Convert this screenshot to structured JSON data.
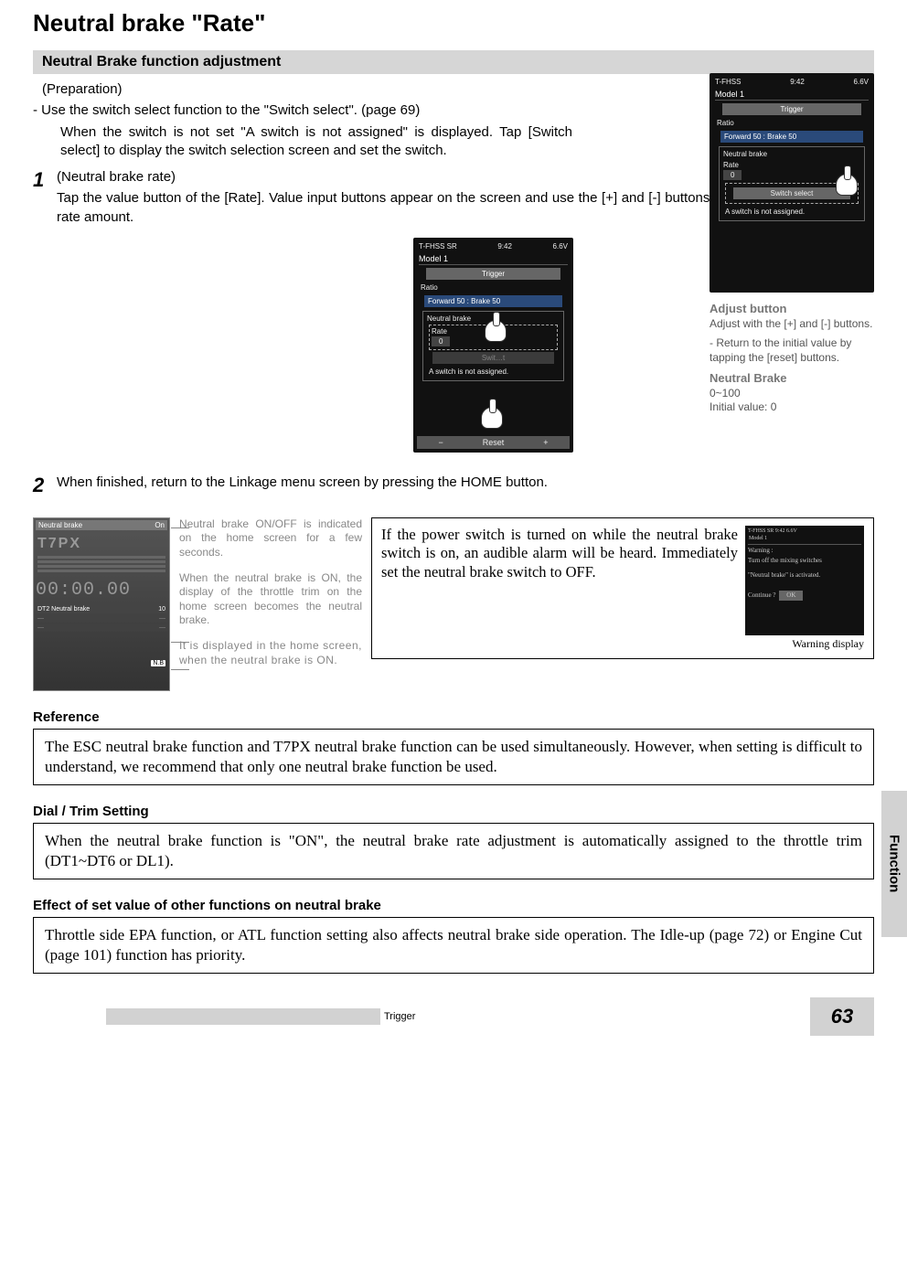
{
  "title": "Neutral brake \"Rate\"",
  "sub_bar": "Neutral Brake function adjustment",
  "preparation_label": "(Preparation)",
  "dash_line": "- Use the switch select function to the \"Switch select\". (page 69)",
  "intro_para": "When the switch is not set \"A switch is not assigned\" is displayed. Tap [Switch select] to display the switch selection screen and set the switch.",
  "step1": {
    "num": "1",
    "label": "(Neutral brake rate)",
    "body": "Tap the value button of the [Rate]. Value input buttons appear on the screen and use the [+] and [-] buttons to adjust the neutral brake rate amount."
  },
  "step2": {
    "num": "2",
    "body": "When finished, return to the Linkage menu screen by pressing the HOME button."
  },
  "screens": {
    "status_left": "T-FHSS",
    "status_left2": "T-FHSS SR",
    "status_time": "9:42",
    "status_batt": "6.6V",
    "model": "Model 1",
    "trigger": "Trigger",
    "ratio_label": "Ratio",
    "ratio_value": "Forward 50 : Brake 50",
    "neutral_brake_label": "Neutral brake",
    "rate_label": "Rate",
    "rate_value": "0",
    "switch_select": "Switch select",
    "not_assigned": "A switch is not assigned.",
    "reset_minus": "−",
    "reset_label": "Reset",
    "reset_plus": "+"
  },
  "adjust_note": {
    "h1": "Adjust button",
    "p1": "Adjust with the [+] and [-] buttons.",
    "p2": "- Return to the initial value by tapping the [reset] buttons.",
    "h2": "Neutral Brake",
    "p3": "0~100",
    "p4": "Initial value: 0"
  },
  "home_shot": {
    "bar_label": "Neutral brake",
    "bar_state": "On",
    "brand": "T7PX",
    "time": "00:00.00",
    "dt_row_l": "DT2  Neutral brake",
    "dt_row_r": "10",
    "nb_badge": "N.B"
  },
  "gray_notes": {
    "n1": "Neutral brake ON/OFF is indicated on the home screen for a few seconds.",
    "n2": "When the neutral brake is ON, the display of the throttle trim on the home screen becomes the neutral brake.",
    "n3": "It is displayed in the home screen, when the neutral brake is ON."
  },
  "warn_box": {
    "text": "If the power switch is turned on while the neutral brake switch is on, an audible alarm will be heard. Immediately set the neutral brake switch to OFF.",
    "caption": "Warning display",
    "screen": {
      "warning": "Warning :",
      "line1": "Turn off the mixing switches",
      "line2": "\"Neutral brake\" is activated.",
      "q": "Continue ?",
      "ok": "OK"
    }
  },
  "reference": {
    "h": "Reference",
    "body": "The ESC neutral brake function and T7PX neutral brake function can be used simultaneously. However, when setting is difficult to understand, we recommend that only one neutral brake function be used."
  },
  "dial": {
    "h": "Dial / Trim Setting",
    "body": "When the neutral brake function is \"ON\", the neutral brake rate adjustment is automatically assigned to the throttle trim (DT1~DT6  or DL1)."
  },
  "effect": {
    "h": "Effect of set value of other functions on neutral brake",
    "body": "Throttle side EPA function, or ATL function setting also affects neutral brake side operation. The Idle-up (page 72) or Engine Cut (page 101) function has priority."
  },
  "footer": {
    "trigger": "Trigger",
    "page": "63",
    "side": "Function"
  }
}
